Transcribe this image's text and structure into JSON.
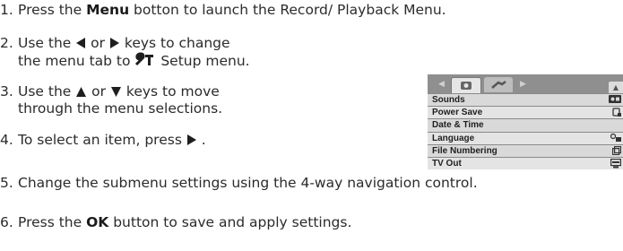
{
  "steps": [
    {
      "num": "1.",
      "pre": "Press the ",
      "bold": "Menu",
      "post": " botton to launch the Record/ Playback Menu."
    },
    {
      "num": "2.",
      "a": "Use the ",
      "b": " or ",
      "c": " keys to change",
      "line2a": "the menu tab to ",
      "line2b": " Setup menu."
    },
    {
      "num": "3.",
      "a": "Use the ",
      "b": " or ",
      "c": " keys to move",
      "line2": "through the menu selections."
    },
    {
      "num": "4.",
      "a": "To select an item, press ",
      "b": " ."
    },
    {
      "num": "5.",
      "text": "Change the submenu settings using the 4-way navigation control."
    },
    {
      "num": "6.",
      "pre": "Press the ",
      "bold": "OK",
      "post": " button to save and apply settings."
    }
  ],
  "menu": {
    "items": [
      {
        "label": "Sounds",
        "icon": "on-icon"
      },
      {
        "label": "Power Save",
        "icon": "power-save-icon"
      },
      {
        "label": "Date & Time",
        "icon": ""
      },
      {
        "label": "Language",
        "icon": "language-icon"
      },
      {
        "label": "File Numbering",
        "icon": "file-numbering-icon"
      },
      {
        "label": "TV Out",
        "icon": "tv-out-icon"
      }
    ]
  },
  "colors": {
    "text": "#2b2b2b",
    "panel": "#8a8a8a",
    "row": "#d9d9d9"
  }
}
